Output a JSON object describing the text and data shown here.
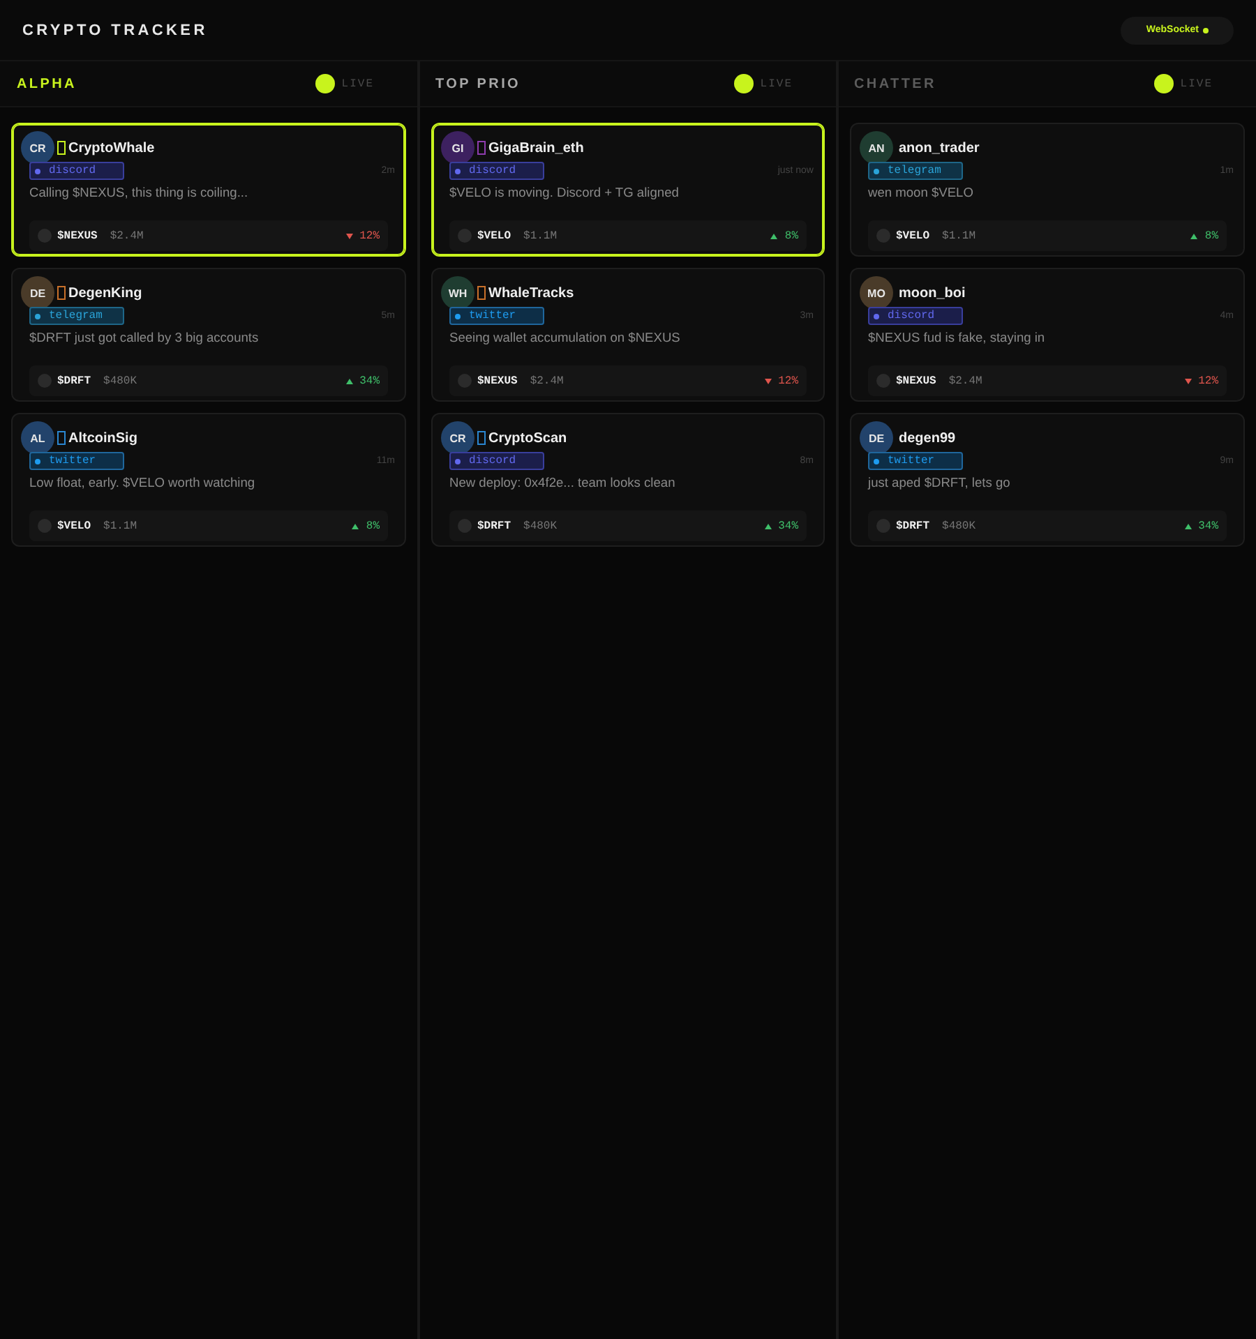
{
  "header": {
    "title": "CRYPTO TRACKER",
    "connection": {
      "label": "WebSocket",
      "connected": true
    }
  },
  "columns": [
    {
      "title": "ALPHA",
      "color": "#c8f31d",
      "live": {
        "label": "LIVE",
        "on": true
      },
      "cards": [
        {
          "selected": true,
          "avatar": {
            "initials": "CR",
            "color": "#22436b"
          },
          "marker": {
            "color": "#c8f31d"
          },
          "name": "CryptoWhale",
          "source": {
            "kind": "discord",
            "label": "discord"
          },
          "time": "2m",
          "message": "Calling $NEXUS, this thing is coiling...",
          "token": {
            "symbol": "$NEXUS",
            "price": "$2.4M",
            "kind": "down",
            "change": "12%"
          }
        },
        {
          "selected": false,
          "avatar": {
            "initials": "DE",
            "color": "#4a3b29"
          },
          "marker": {
            "color": "#c8702a"
          },
          "name": "DegenKing",
          "source": {
            "kind": "telegram",
            "label": "telegram"
          },
          "time": "5m",
          "message": "$DRFT just got called by 3 big accounts",
          "token": {
            "symbol": "$DRFT",
            "price": "$480K",
            "kind": "up",
            "change": "34%"
          }
        },
        {
          "selected": false,
          "avatar": {
            "initials": "AL",
            "color": "#22436b"
          },
          "marker": {
            "color": "#2a86d0"
          },
          "name": "AltcoinSig",
          "source": {
            "kind": "twitter",
            "label": "twitter"
          },
          "time": "11m",
          "message": "Low float, early. $VELO worth watching",
          "token": {
            "symbol": "$VELO",
            "price": "$1.1M",
            "kind": "up",
            "change": "8%"
          }
        }
      ]
    },
    {
      "title": "TOP PRIO",
      "color": "#a8a8a8",
      "live": {
        "label": "LIVE",
        "on": true
      },
      "cards": [
        {
          "selected": true,
          "avatar": {
            "initials": "GI",
            "color": "#3d2160"
          },
          "marker": {
            "color": "#8e3cae"
          },
          "name": "GigaBrain_eth",
          "source": {
            "kind": "discord",
            "label": "discord"
          },
          "time": "just now",
          "message": "$VELO is moving. Discord + TG aligned",
          "token": {
            "symbol": "$VELO",
            "price": "$1.1M",
            "kind": "up",
            "change": "8%"
          }
        },
        {
          "selected": false,
          "avatar": {
            "initials": "WH",
            "color": "#1f3d31"
          },
          "marker": {
            "color": "#c8702a"
          },
          "name": "WhaleTracks",
          "source": {
            "kind": "twitter",
            "label": "twitter"
          },
          "time": "3m",
          "message": "Seeing wallet accumulation on $NEXUS",
          "token": {
            "symbol": "$NEXUS",
            "price": "$2.4M",
            "kind": "down",
            "change": "12%"
          }
        },
        {
          "selected": false,
          "avatar": {
            "initials": "CR",
            "color": "#22436b"
          },
          "marker": {
            "color": "#2a86d0"
          },
          "name": "CryptoScan",
          "source": {
            "kind": "discord",
            "label": "discord"
          },
          "time": "8m",
          "message": "New deploy: 0x4f2e... team looks clean",
          "token": {
            "symbol": "$DRFT",
            "price": "$480K",
            "kind": "up",
            "change": "34%"
          }
        }
      ]
    },
    {
      "title": "CHATTER",
      "color": "#5c5c5c",
      "live": {
        "label": "LIVE",
        "on": true
      },
      "cards": [
        {
          "selected": false,
          "avatar": {
            "initials": "AN",
            "color": "#1f3d31"
          },
          "name": "anon_trader",
          "source": {
            "kind": "telegram",
            "label": "telegram"
          },
          "time": "1m",
          "message": "wen moon $VELO",
          "token": {
            "symbol": "$VELO",
            "price": "$1.1M",
            "kind": "up",
            "change": "8%"
          }
        },
        {
          "selected": false,
          "avatar": {
            "initials": "MO",
            "color": "#4a3b29"
          },
          "name": "moon_boi",
          "source": {
            "kind": "discord",
            "label": "discord"
          },
          "time": "4m",
          "message": "$NEXUS fud is fake, staying in",
          "token": {
            "symbol": "$NEXUS",
            "price": "$2.4M",
            "kind": "down",
            "change": "12%"
          }
        },
        {
          "selected": false,
          "avatar": {
            "initials": "DE",
            "color": "#22436b"
          },
          "name": "degen99",
          "source": {
            "kind": "twitter",
            "label": "twitter"
          },
          "time": "9m",
          "message": "just aped $DRFT, lets go",
          "token": {
            "symbol": "$DRFT",
            "price": "$480K",
            "kind": "up",
            "change": "34%"
          }
        }
      ]
    }
  ]
}
